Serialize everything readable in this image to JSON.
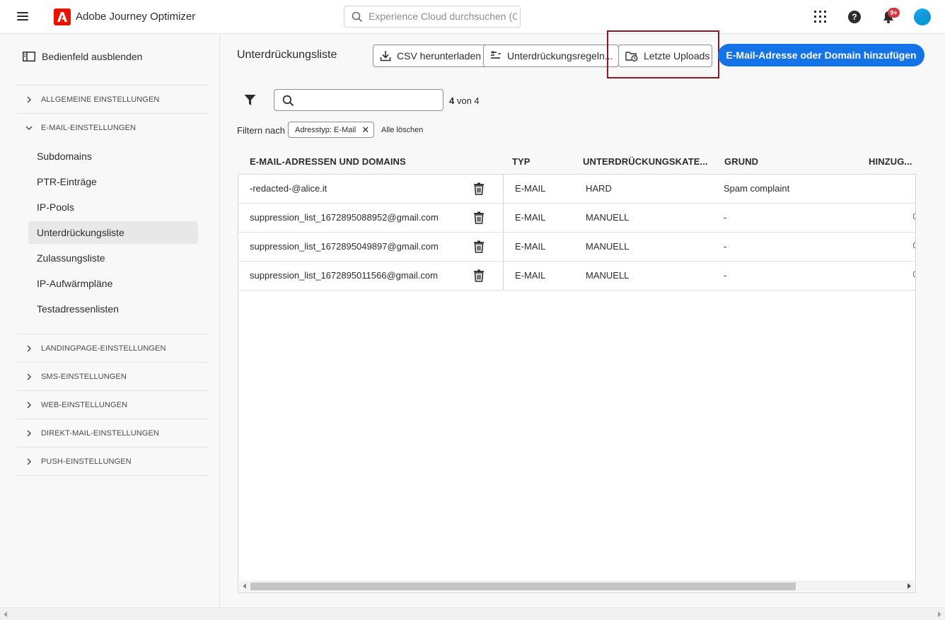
{
  "app": {
    "title": "Adobe Journey Optimizer"
  },
  "search": {
    "placeholder": "Experience Cloud durchsuchen (Ctr..."
  },
  "topbar": {
    "notification_badge": "9+"
  },
  "sidebar": {
    "toggle_label": "Bedienfeld ausblenden",
    "sections": [
      {
        "label": "ALLGEMEINE EINSTELLUNGEN",
        "expanded": false
      },
      {
        "label": "E-MAIL-EINSTELLUNGEN",
        "expanded": true
      },
      {
        "label": "LANDINGPAGE-EINSTELLUNGEN",
        "expanded": false
      },
      {
        "label": "SMS-EINSTELLUNGEN",
        "expanded": false
      },
      {
        "label": "WEB-EINSTELLUNGEN",
        "expanded": false
      },
      {
        "label": "DIREKT-MAIL-EINSTELLUNGEN",
        "expanded": false
      },
      {
        "label": "PUSH-EINSTELLUNGEN",
        "expanded": false
      }
    ],
    "email_items": [
      {
        "label": "Subdomains"
      },
      {
        "label": "PTR-Einträge"
      },
      {
        "label": "IP-Pools"
      },
      {
        "label": "Unterdrückungsliste",
        "active": true
      },
      {
        "label": "Zulassungsliste"
      },
      {
        "label": "IP-Aufwärmpläne"
      },
      {
        "label": "Testadressenlisten"
      }
    ]
  },
  "main": {
    "title": "Unterdrückungsliste",
    "toolbar": {
      "csv_download": "CSV herunterladen",
      "suppression_rules": "Unterdrückungsregeln...",
      "recent_uploads": "Letzte Uploads",
      "add_address": "E-Mail-Adresse oder Domain hinzufügen"
    },
    "count": {
      "shown": "4",
      "suffix": " von 4"
    },
    "filter": {
      "label": "Filtern nach",
      "chip": "Adresstyp: E-Mail",
      "clear_all": "Alle löschen"
    },
    "table": {
      "columns": [
        "E-MAIL-ADRESSEN UND DOMAINS",
        "TYP",
        "UNTERDRÜCKUNGSKATE...",
        "GRUND",
        "HINZUG..."
      ],
      "rows": [
        {
          "address": "-redacted-@alice.it",
          "type": "E-MAIL",
          "category": "HARD",
          "reason": "Spam complaint"
        },
        {
          "address": "suppression_list_1672895088952@gmail.com",
          "type": "E-MAIL",
          "category": "MANUELL",
          "reason": "-"
        },
        {
          "address": "suppression_list_1672895049897@gmail.com",
          "type": "E-MAIL",
          "category": "MANUELL",
          "reason": "-"
        },
        {
          "address": "suppression_list_1672895011566@gmail.com",
          "type": "E-MAIL",
          "category": "MANUELL",
          "reason": "-"
        }
      ]
    }
  },
  "colors": {
    "accent": "#1473e6",
    "brand": "#eb1000",
    "highlight": "#8b1a24",
    "badge": "#d7373f"
  }
}
